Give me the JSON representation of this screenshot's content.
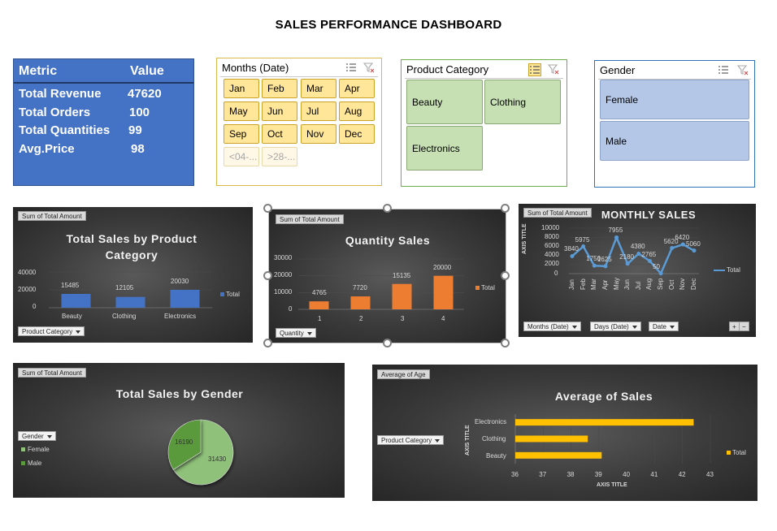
{
  "page": {
    "title": "SALES PERFORMANCE DASHBOARD"
  },
  "metrics": {
    "header": {
      "metric": "Metric",
      "value": "Value"
    },
    "rows": [
      {
        "label": "Total Revenue",
        "value": "47620"
      },
      {
        "label": "Total Orders",
        "value": "100"
      },
      {
        "label": "Total Quantities",
        "value": "99"
      },
      {
        "label": "Avg.Price",
        "value": "98"
      }
    ]
  },
  "slicers": {
    "months": {
      "title": "Months (Date)",
      "items": [
        "Jan",
        "Feb",
        "Mar",
        "Apr",
        "May",
        "Jun",
        "Jul",
        "Aug",
        "Sep",
        "Oct",
        "Nov",
        "Dec"
      ],
      "disabled": [
        "<04-...",
        ">28-..."
      ]
    },
    "category": {
      "title": "Product Category",
      "items": [
        "Beauty",
        "Clothing",
        "Electronics"
      ]
    },
    "gender": {
      "title": "Gender",
      "items": [
        "Female",
        "Male"
      ]
    }
  },
  "charts": {
    "category_sales": {
      "field_tag": "Sum of Total Amount",
      "filter": "Product Category",
      "legend": "Total",
      "title_line1": "Total Sales by Product",
      "title_line2": "Category",
      "y_ticks": [
        "40000",
        "20000",
        "0"
      ],
      "color": "#4472c4"
    },
    "quantity_sales": {
      "field_tag": "Sum of Total Amount",
      "filter": "Quantity",
      "legend": "Total",
      "title": "Quantity Sales",
      "y_ticks": [
        "30000",
        "20000",
        "10000",
        "0"
      ],
      "color": "#ed7d31"
    },
    "monthly_sales": {
      "field_tag": "Sum of Total Amount",
      "title": "MONTHLY SALES",
      "axis_title": "AXIS TITLE",
      "legend": "Total",
      "y_ticks": [
        "10000",
        "8000",
        "6000",
        "4000",
        "2000",
        "0"
      ],
      "filters": [
        "Months (Date)",
        "Days (Date)",
        "Date"
      ],
      "zoom_in": "+",
      "zoom_out": "−",
      "color": "#5b9bd5"
    },
    "gender_sales": {
      "field_tag": "Sum of Total Amount",
      "filter": "Gender",
      "title": "Total Sales by Gender",
      "legend": [
        "Female",
        "Male"
      ],
      "colors": [
        "#8fc17a",
        "#5a9a3c"
      ]
    },
    "avg_sales": {
      "field_tag": "Average of Age",
      "filter": "Product Category",
      "title": "Average of Sales",
      "y_axis_title": "AXIS TITLE",
      "x_axis_title": "AXIS TITLE",
      "legend": "Total",
      "color": "#ffc000"
    }
  },
  "chart_data": [
    {
      "type": "bar",
      "categories": [
        "Beauty",
        "Clothing",
        "Electronics"
      ],
      "series": [
        {
          "name": "Total",
          "values": [
            15485,
            12105,
            20030
          ]
        }
      ],
      "title": "Total Sales by Product Category",
      "ylim": [
        0,
        40000
      ]
    },
    {
      "type": "bar",
      "categories": [
        "1",
        "2",
        "3",
        "4"
      ],
      "series": [
        {
          "name": "Total",
          "values": [
            4765,
            7720,
            15135,
            20000
          ]
        }
      ],
      "title": "Quantity Sales",
      "ylim": [
        0,
        30000
      ]
    },
    {
      "type": "line",
      "categories": [
        "Jan",
        "Feb",
        "Mar",
        "Apr",
        "May",
        "Jun",
        "Jul",
        "Aug",
        "Sep",
        "Oct",
        "Nov",
        "Dec"
      ],
      "series": [
        {
          "name": "Total",
          "values": [
            3840,
            5975,
            1750,
            1625,
            7955,
            2180,
            4380,
            2765,
            50,
            5620,
            6420,
            5060
          ]
        }
      ],
      "title": "MONTHLY SALES",
      "ylabel": "AXIS TITLE",
      "ylim": [
        0,
        10000
      ]
    },
    {
      "type": "pie",
      "categories": [
        "Female",
        "Male"
      ],
      "values": [
        31430,
        16190
      ],
      "title": "Total Sales by Gender"
    },
    {
      "type": "bar",
      "orientation": "horizontal",
      "categories": [
        "Beauty",
        "Clothing",
        "Electronics"
      ],
      "series": [
        {
          "name": "Total",
          "values": [
            39.1,
            38.6,
            42.4
          ]
        }
      ],
      "title": "Average of Sales",
      "xlabel": "AXIS TITLE",
      "ylabel": "AXIS TITLE",
      "xlim": [
        36,
        43
      ],
      "x_ticks": [
        "36",
        "37",
        "38",
        "39",
        "40",
        "41",
        "42",
        "43"
      ]
    }
  ]
}
